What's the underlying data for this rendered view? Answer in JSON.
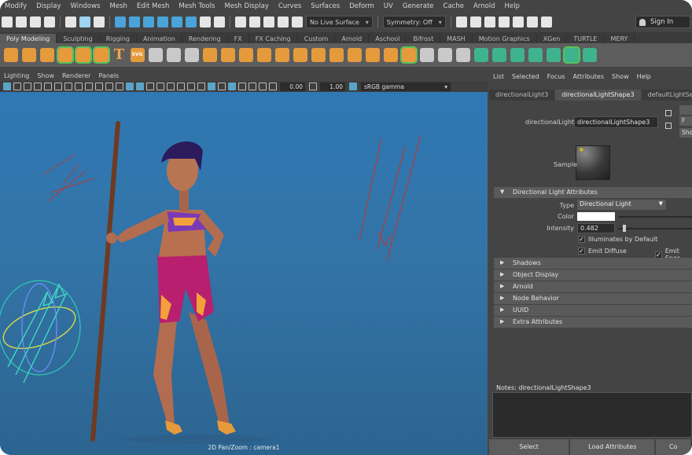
{
  "menubar": [
    "Modify",
    "Display",
    "Windows",
    "Mesh",
    "Edit Mesh",
    "Mesh Tools",
    "Mesh Display",
    "Curves",
    "Surfaces",
    "Deform",
    "UV",
    "Generate",
    "Cache",
    "Arnold",
    "Help"
  ],
  "statusline": {
    "live_surface": "No Live Surface",
    "symmetry": "Symmetry: Off",
    "sign_in": "Sign In"
  },
  "shelf_tabs": [
    "Poly Modeling",
    "Sculpting",
    "Rigging",
    "Animation",
    "Rendering",
    "FX",
    "FX Caching",
    "Custom",
    "Arnold",
    "Aschool",
    "Bifrost",
    "MASH",
    "Motion Graphics",
    "XGen",
    "TURTLE",
    "MERY"
  ],
  "active_shelf_tab": "Poly Modeling",
  "shelf": {
    "text_tool_glyph": "T",
    "svg_tool_label": "SVG"
  },
  "viewport": {
    "menu": [
      "Lighting",
      "Show",
      "Renderer",
      "Panels"
    ],
    "exposure": "0.00",
    "gamma_value": "1.00",
    "color_space": "sRGB gamma",
    "camera_label": "2D Pan/Zoom : camera1"
  },
  "attribute_editor": {
    "menu": [
      "List",
      "Selected",
      "Focus",
      "Attributes",
      "Show",
      "Help"
    ],
    "tabs": [
      "directionalLight3",
      "directionalLightShape3",
      "defaultLightSet"
    ],
    "active_tab": "directionalLightShape3",
    "node_label": "directionalLight:",
    "node_value": "directionalLightShape3",
    "side_buttons": [
      "F",
      "Sho"
    ],
    "sample_label": "Sample",
    "sections": {
      "directional_light": "Directional Light Attributes",
      "collapsed": [
        "Shadows",
        "Object Display",
        "Arnold",
        "Node Behavior",
        "UUID",
        "Extra Attributes"
      ]
    },
    "type_label": "Type",
    "type_value": "Directional Light",
    "color_label": "Color",
    "color_value": "#ffffff",
    "intensity_label": "Intensity",
    "intensity_value": "0.482",
    "illuminates_default": "Illuminates by Default",
    "emit_diffuse": "Emit Diffuse",
    "emit_specular": "Emit Spec",
    "notes_label": "Notes: directionalLightShape3",
    "buttons": [
      "Select",
      "Load Attributes",
      "Co"
    ]
  }
}
